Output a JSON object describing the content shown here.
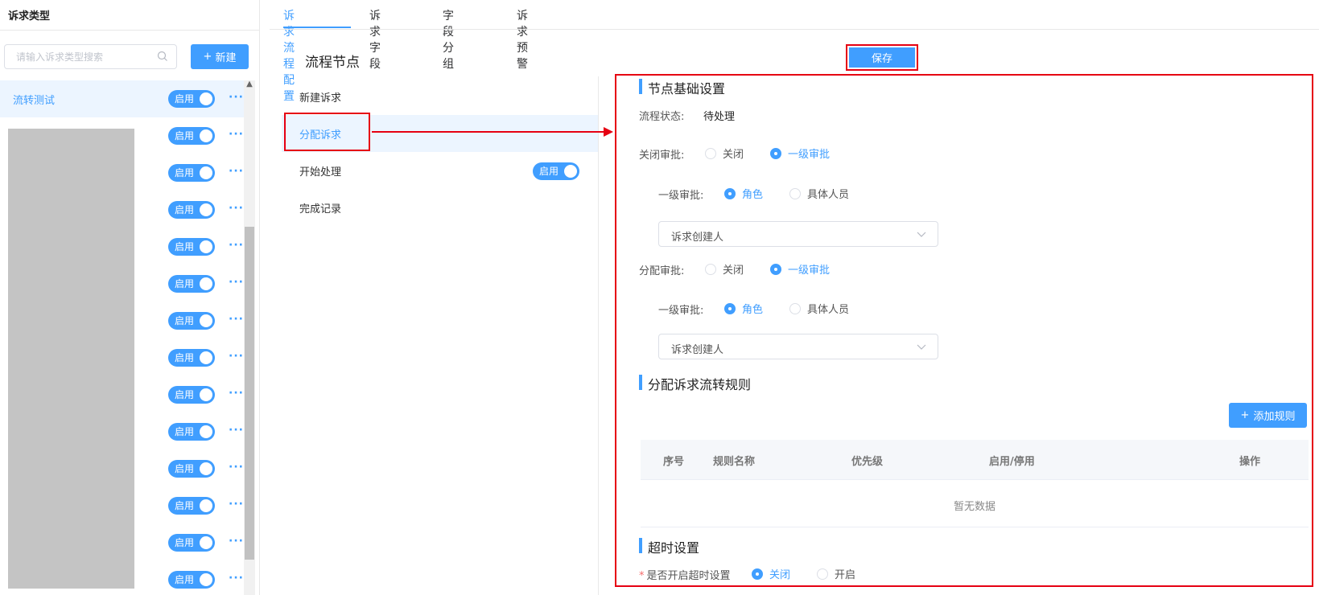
{
  "left": {
    "title": "诉求类型",
    "search_placeholder": "请输入诉求类型搜索",
    "new_button_label": "新建",
    "types": [
      {
        "name": "流转测试",
        "toggle_label": "启用",
        "active": true
      },
      {
        "name": "",
        "toggle_label": "启用"
      },
      {
        "name": "",
        "toggle_label": "启用"
      },
      {
        "name": "",
        "toggle_label": "启用"
      },
      {
        "name": "",
        "toggle_label": "启用"
      },
      {
        "name": "",
        "toggle_label": "启用"
      },
      {
        "name": "",
        "toggle_label": "启用"
      },
      {
        "name": "",
        "toggle_label": "启用"
      },
      {
        "name": "",
        "toggle_label": "启用"
      },
      {
        "name": "",
        "toggle_label": "启用"
      },
      {
        "name": "",
        "toggle_label": "启用"
      },
      {
        "name": "",
        "toggle_label": "启用"
      },
      {
        "name": "",
        "toggle_label": "启用"
      },
      {
        "name": "",
        "toggle_label": "启用"
      }
    ],
    "more_label": "···"
  },
  "tabs": [
    {
      "label": "诉求流程配置",
      "active": true
    },
    {
      "label": "诉求字段"
    },
    {
      "label": "字段分组"
    },
    {
      "label": "诉求预警"
    }
  ],
  "nodes": {
    "title": "流程节点",
    "items": [
      {
        "label": "新建诉求"
      },
      {
        "label": "分配诉求",
        "active": true
      },
      {
        "label": "开始处理",
        "toggle_label": "启用"
      },
      {
        "label": "完成记录"
      }
    ]
  },
  "save_label": "保存",
  "config": {
    "basic_title": "节点基础设置",
    "status_label": "流程状态:",
    "status_value": "待处理",
    "close_approval": {
      "label": "关闭审批:",
      "options": [
        "关闭",
        "一级审批"
      ],
      "selected": "一级审批",
      "level_label": "一级审批:",
      "level_options": [
        "角色",
        "具体人员"
      ],
      "level_selected": "角色",
      "select_value": "诉求创建人"
    },
    "assign_approval": {
      "label": "分配审批:",
      "options": [
        "关闭",
        "一级审批"
      ],
      "selected": "一级审批",
      "level_label": "一级审批:",
      "level_options": [
        "角色",
        "具体人员"
      ],
      "level_selected": "角色",
      "select_value": "诉求创建人"
    },
    "rule_title": "分配诉求流转规则",
    "add_rule_label": "添加规则",
    "rule_columns": [
      "序号",
      "规则名称",
      "优先级",
      "启用/停用",
      "操作"
    ],
    "rule_empty": "暂无数据",
    "timeout_title": "超时设置",
    "timeout_label": "是否开启超时设置",
    "timeout_options": [
      "关闭",
      "开启"
    ],
    "timeout_selected": "关闭"
  },
  "colors": {
    "accent": "#409eff",
    "highlight": "#e60012",
    "selected_bg": "#ecf5ff"
  }
}
